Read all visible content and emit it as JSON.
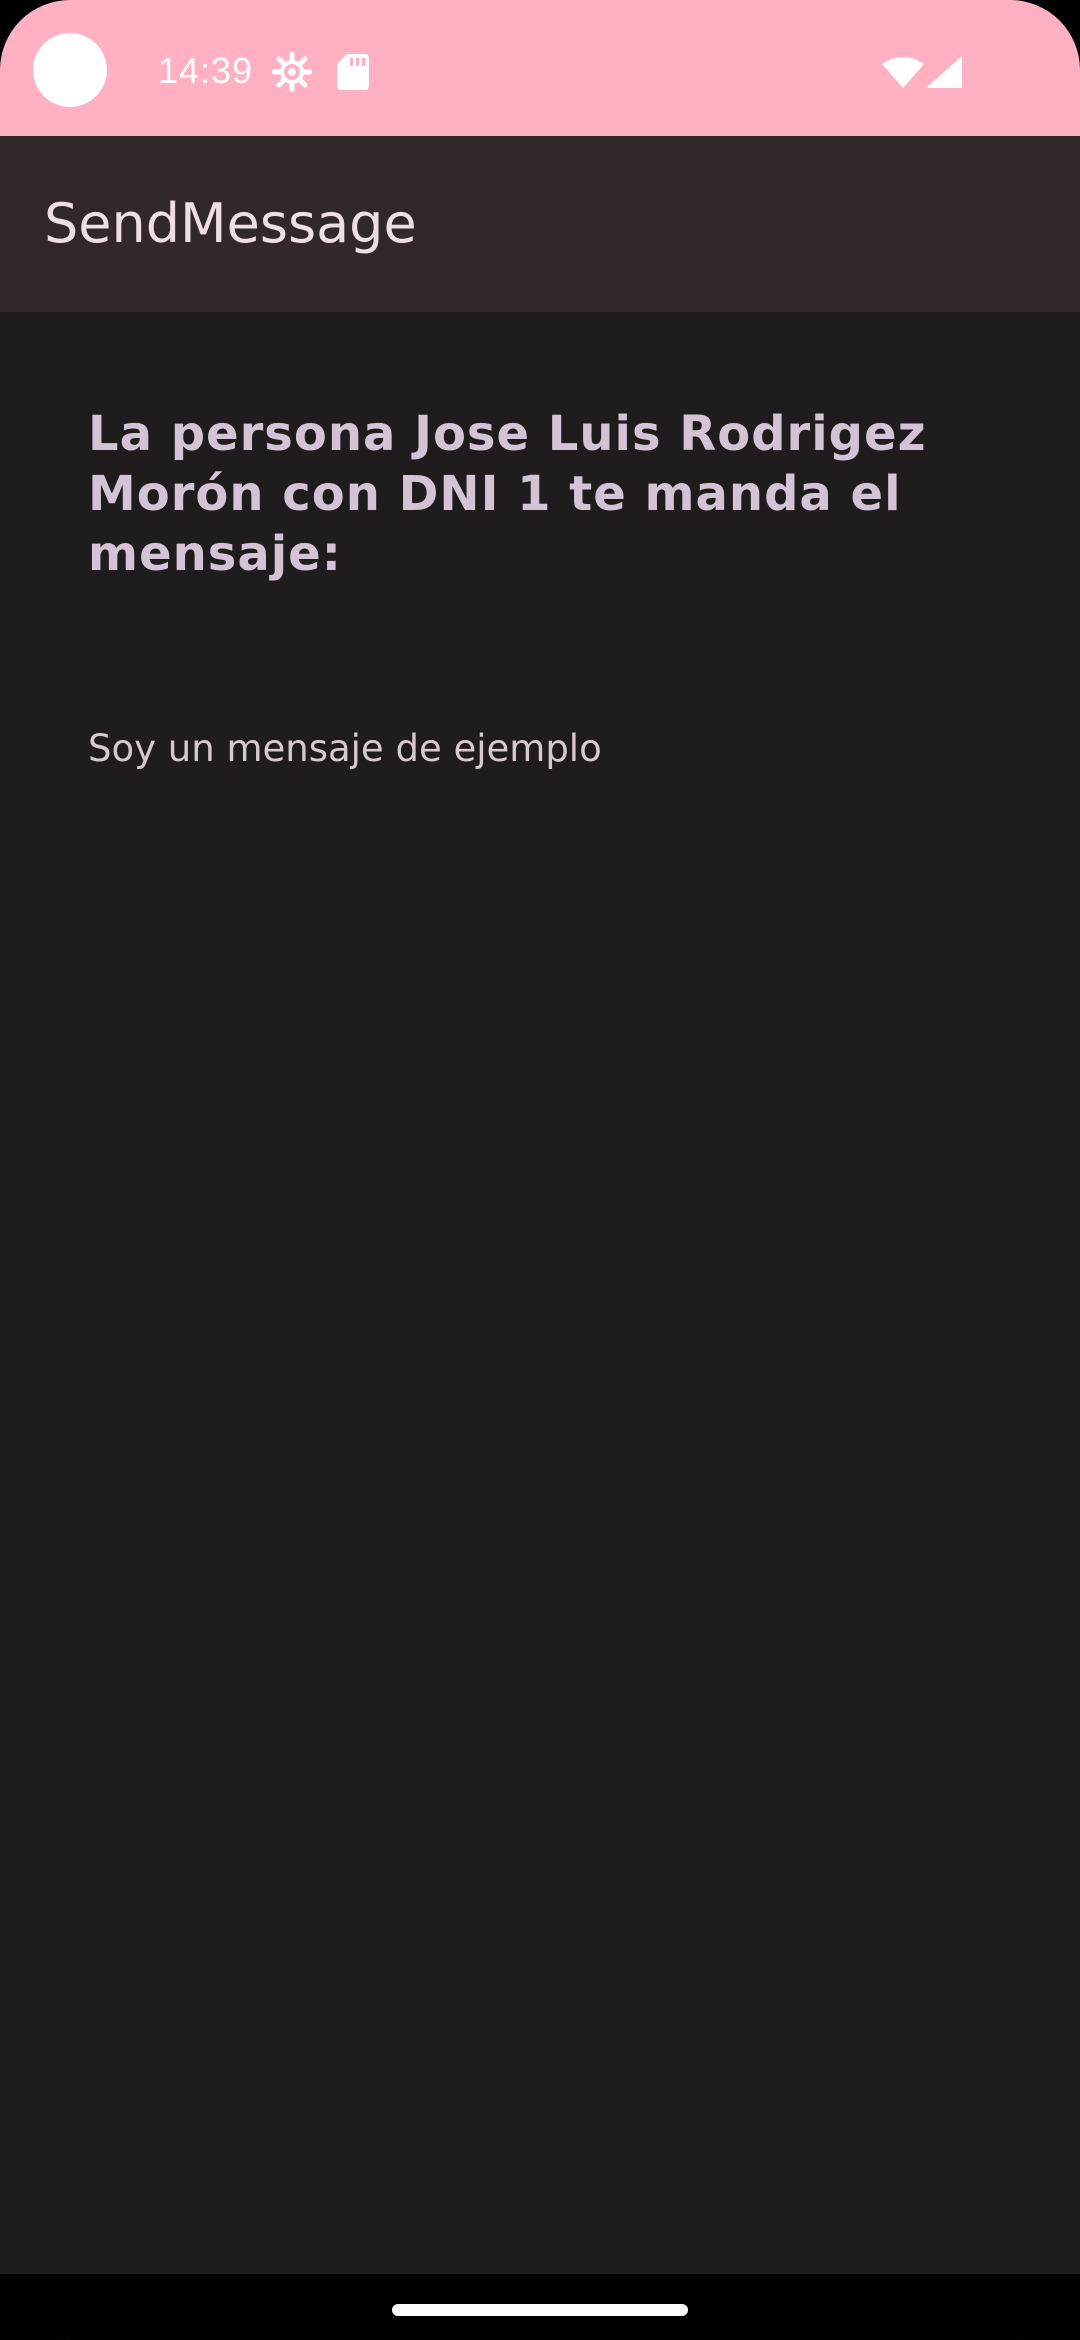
{
  "status_bar": {
    "time": "14:39",
    "icons": [
      "camera-cutout",
      "gear-icon",
      "sd-card-icon",
      "wifi-icon",
      "signal-icon"
    ],
    "background_color": "#ffb0c2"
  },
  "app_bar": {
    "title": "SendMessage",
    "background_color": "#322829"
  },
  "message": {
    "header": "La persona Jose Luis Rodrigez Morón con DNI 1 te manda el mensaje:",
    "body": "Soy un mensaje de ejemplo"
  },
  "colors": {
    "content_background": "#201b1c",
    "header_text": "#d2c4d5",
    "body_text": "#d6c9d0"
  }
}
